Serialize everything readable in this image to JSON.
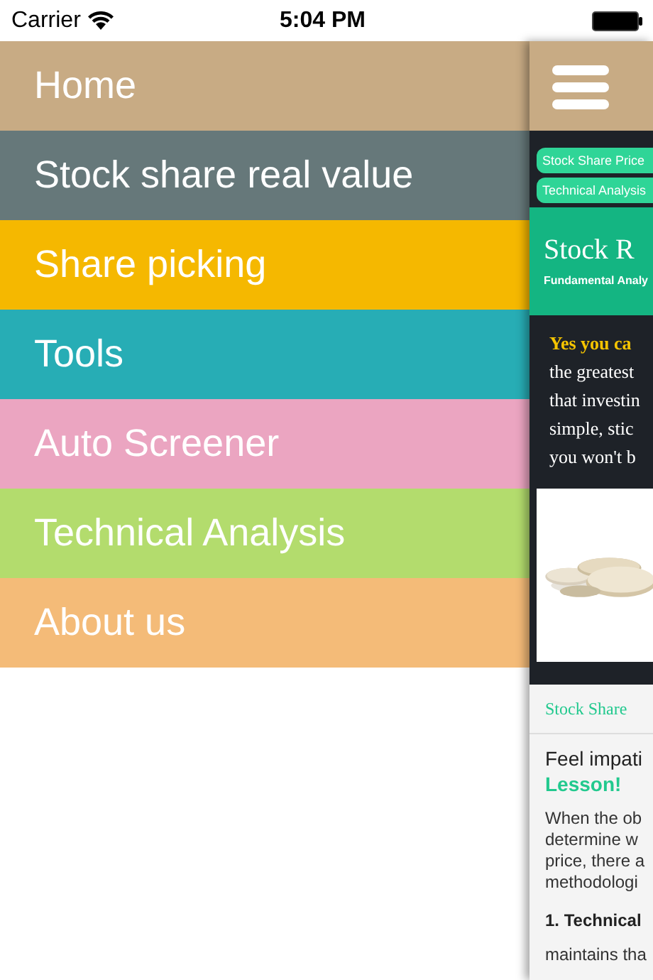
{
  "status_bar": {
    "carrier": "Carrier",
    "time": "5:04 PM"
  },
  "menu": {
    "items": [
      {
        "label": "Home",
        "color": "#c8ab84"
      },
      {
        "label": "Stock share real value",
        "color": "#66787a"
      },
      {
        "label": "Share picking",
        "color": "#f5b800"
      },
      {
        "label": "Tools",
        "color": "#27adb5"
      },
      {
        "label": "Auto Screener",
        "color": "#eba5c1"
      },
      {
        "label": "Technical Analysis",
        "color": "#b3dc6d"
      },
      {
        "label": "About us",
        "color": "#f4bb78"
      }
    ]
  },
  "content_preview": {
    "tabs": [
      {
        "label": "Stock Share Price"
      },
      {
        "label": "Technical Analysis"
      }
    ],
    "banner_title": "Stock R",
    "banner_subtitle": "Fundamental Analy",
    "intro_highlight": "Yes you ca",
    "intro_lines": [
      "the greatest",
      "that investin",
      "simple, stic",
      "you won't b"
    ],
    "image": {
      "kind": "picture"
    },
    "section_title": "Stock Share",
    "heading": "Feel impati",
    "heading_emphasis": "Lesson!",
    "body_lines": [
      "When the ob",
      "determine w",
      "price, there a",
      "methodologi"
    ],
    "subheading": "1. Technical",
    "after_lines": [
      "maintains tha"
    ]
  }
}
